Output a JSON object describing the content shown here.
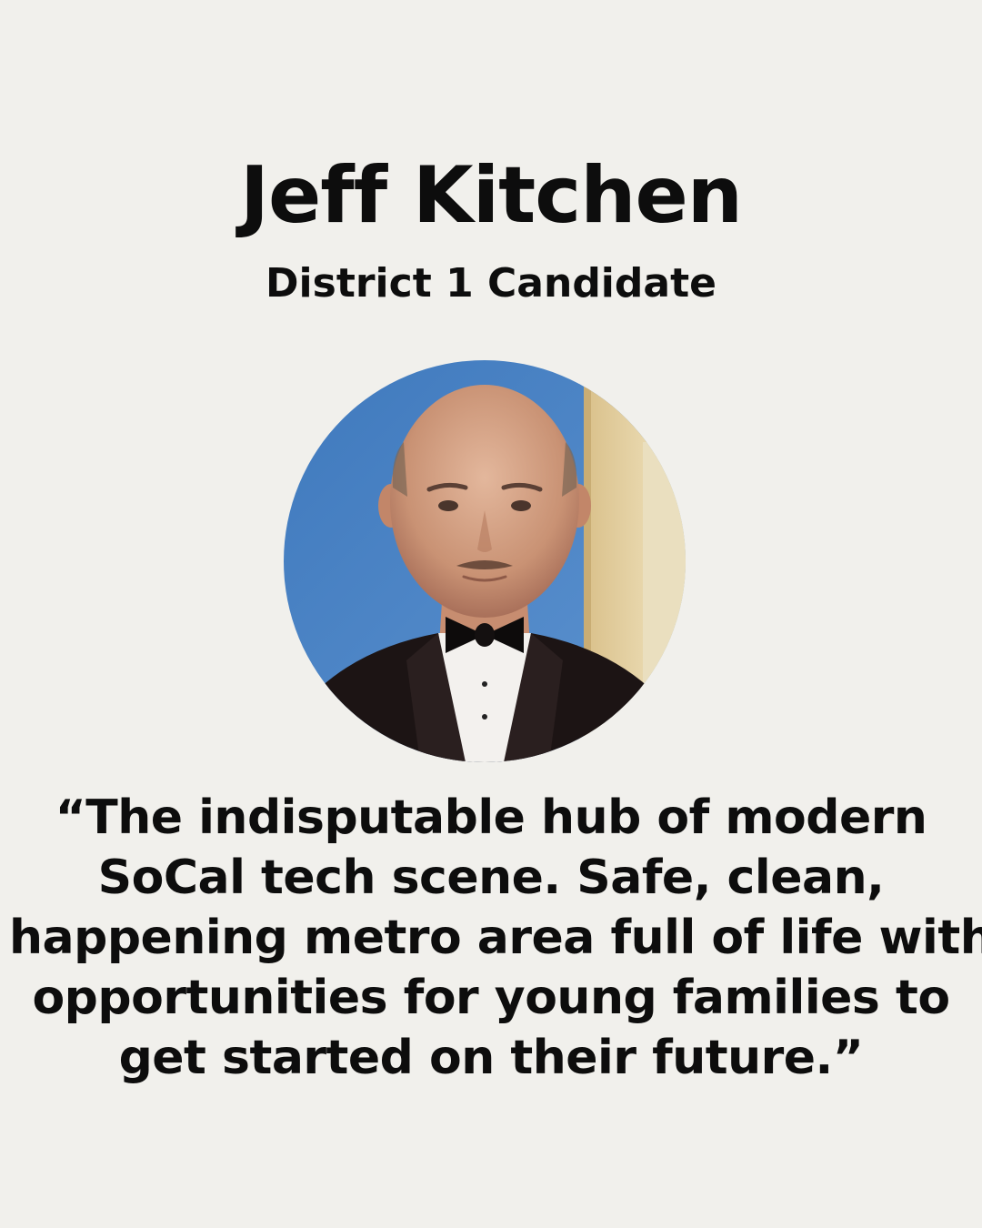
{
  "candidate": {
    "name": "Jeff Kitchen",
    "title": "District 1 Candidate"
  },
  "quote": {
    "lines": [
      "“The indisputable hub of modern",
      "SoCal tech scene. Safe, clean,",
      "happening metro area full of life with",
      "opportunities for young families to",
      "get started on their future.”"
    ]
  },
  "colors": {
    "background": "#f1f0ec",
    "text": "#0d0d0d",
    "photo_wall": "#4f86c6",
    "photo_door": "#e8d7a8"
  }
}
